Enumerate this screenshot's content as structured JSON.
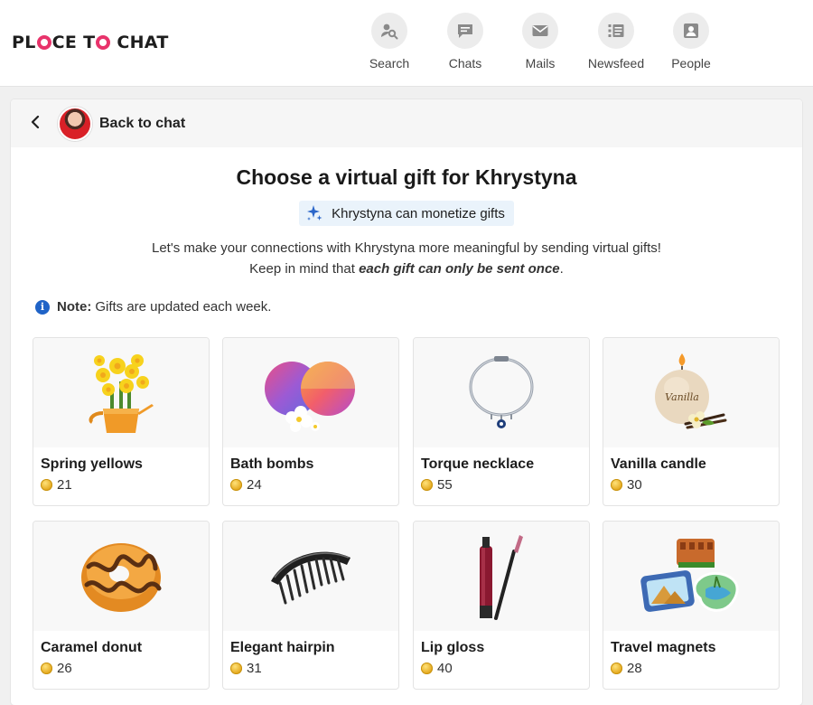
{
  "brand": {
    "logo_left": "PL",
    "logo_mid": "CE T",
    "logo_right": "CHAT",
    "accent_color": "#e8336b"
  },
  "nav": [
    {
      "label": "Search",
      "icon": "search-user-icon"
    },
    {
      "label": "Chats",
      "icon": "chat-bubble-icon"
    },
    {
      "label": "Mails",
      "icon": "envelope-icon"
    },
    {
      "label": "Newsfeed",
      "icon": "newsfeed-icon"
    },
    {
      "label": "People",
      "icon": "person-card-icon"
    }
  ],
  "header": {
    "back_label": "Back to chat"
  },
  "main": {
    "title": "Choose a virtual gift for Khrystyna",
    "badge": "Khrystyna can monetize gifts",
    "intro_text": "Let's make your connections with Khrystyna more meaningful by sending virtual gifts! Keep in mind that ",
    "intro_emphasis": "each gift can only be sent once",
    "intro_end": ".",
    "note_label": "Note:",
    "note_text": "Gifts are updated each week."
  },
  "gifts": [
    {
      "name": "Spring yellows",
      "price": "21",
      "icon": "daffodils-pot-icon"
    },
    {
      "name": "Bath bombs",
      "price": "24",
      "icon": "bath-bombs-icon"
    },
    {
      "name": "Torque necklace",
      "price": "55",
      "icon": "necklace-icon"
    },
    {
      "name": "Vanilla candle",
      "price": "30",
      "icon": "candle-icon"
    },
    {
      "name": "Caramel donut",
      "price": "26",
      "icon": "donut-icon"
    },
    {
      "name": "Elegant hairpin",
      "price": "31",
      "icon": "hair-comb-icon"
    },
    {
      "name": "Lip gloss",
      "price": "40",
      "icon": "lip-gloss-icon"
    },
    {
      "name": "Travel magnets",
      "price": "28",
      "icon": "travel-magnets-icon"
    }
  ],
  "candle_text": "Vanilla"
}
